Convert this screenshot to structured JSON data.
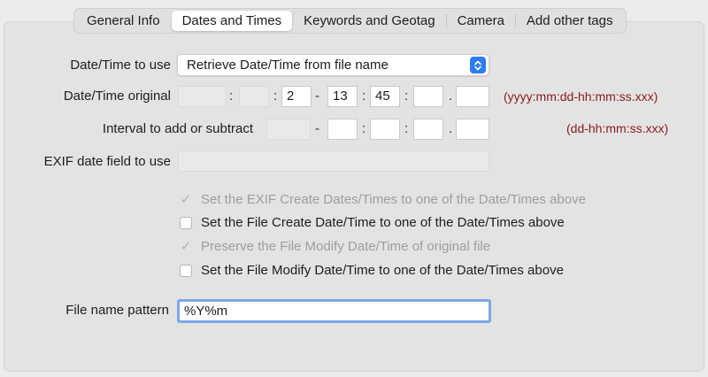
{
  "tabs": [
    {
      "label": "General Info",
      "active": false
    },
    {
      "label": "Dates and Times",
      "active": true
    },
    {
      "label": "Keywords and Geotag",
      "active": false
    },
    {
      "label": "Camera",
      "active": false
    },
    {
      "label": "Add other tags",
      "active": false
    }
  ],
  "datetime_to_use": {
    "label": "Date/Time to use",
    "selected": "Retrieve Date/Time from file name"
  },
  "datetime_original": {
    "label": "Date/Time original",
    "fields": [
      "",
      "",
      "2",
      "13",
      "45",
      "",
      ""
    ],
    "separators": [
      ":",
      ":",
      "-",
      ":",
      ":",
      "."
    ],
    "hint": "(yyyy:mm:dd-hh:mm:ss.xxx)"
  },
  "interval": {
    "label": "Interval to add or subtract",
    "fields": [
      "",
      "",
      "",
      "",
      ""
    ],
    "separators": [
      "-",
      ":",
      ":",
      "."
    ],
    "hint": "(dd-hh:mm:ss.xxx)"
  },
  "exif_field": {
    "label": "EXIF date field to use",
    "value": ""
  },
  "checkboxes": [
    {
      "label": "Set the EXIF Create Dates/Times to one of the Date/Times above",
      "checked": true,
      "disabled": true
    },
    {
      "label": "Set the File Create Date/Time to one of the Date/Times above",
      "checked": false,
      "disabled": false
    },
    {
      "label": "Preserve the File Modify Date/Time of original file",
      "checked": true,
      "disabled": true
    },
    {
      "label": "Set the File Modify Date/Time to one of the Date/Times above",
      "checked": false,
      "disabled": false
    }
  ],
  "file_name_pattern": {
    "label": "File name pattern",
    "value": "%Y%m"
  },
  "colors": {
    "accent": "#2e7cf6",
    "hint": "#8b1a1a",
    "focus_ring": "#7aa7e9"
  }
}
